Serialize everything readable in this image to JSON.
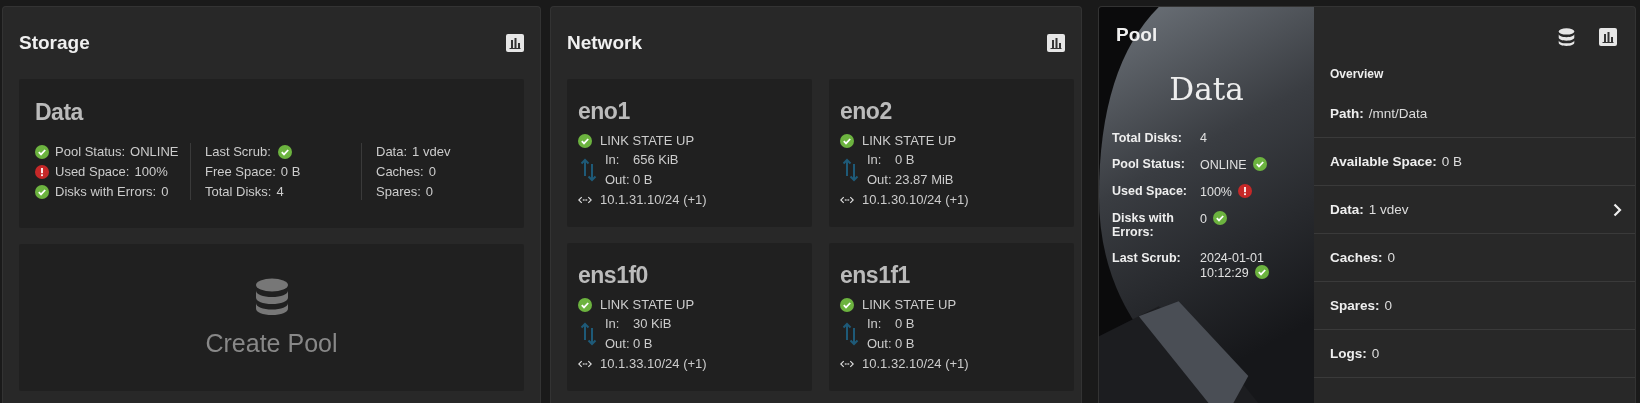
{
  "storage": {
    "title": "Storage",
    "pool": {
      "name": "Data",
      "columns": [
        [
          {
            "label": "Pool Status:",
            "value": "ONLINE",
            "healthy": true
          },
          {
            "label": "Used Space:",
            "value": "100%",
            "healthy": false
          },
          {
            "label": "Disks with Errors:",
            "value": "0",
            "healthy": true
          }
        ],
        [
          {
            "label": "Last Scrub:",
            "healthy": true
          },
          {
            "label": "Free Space:",
            "value": "0 B"
          },
          {
            "label": "Total Disks:",
            "value": "4"
          }
        ],
        [
          {
            "label": "Data:",
            "value": "1 vdev"
          },
          {
            "label": "Caches:",
            "value": "0"
          },
          {
            "label": "Spares:",
            "value": "0"
          }
        ]
      ]
    },
    "create_pool": {
      "label": "Create Pool"
    }
  },
  "network": {
    "title": "Network",
    "interfaces": [
      {
        "name": "eno1",
        "link_state": "LINK STATE UP",
        "link_up": true,
        "in": {
          "label": "In:",
          "value": "656 KiB"
        },
        "out": {
          "label": "Out:",
          "value": "0 B"
        },
        "address": "10.1.31.10/24 (+1)"
      },
      {
        "name": "eno2",
        "link_state": "LINK STATE UP",
        "link_up": true,
        "in": {
          "label": "In:",
          "value": "0 B"
        },
        "out": {
          "label": "Out:",
          "value": "23.87 MiB"
        },
        "address": "10.1.30.10/24 (+1)"
      },
      {
        "name": "ens1f0",
        "link_state": "LINK STATE UP",
        "link_up": true,
        "in": {
          "label": "In:",
          "value": "30 KiB"
        },
        "out": {
          "label": "Out:",
          "value": "0 B"
        },
        "address": "10.1.33.10/24 (+1)"
      },
      {
        "name": "ens1f1",
        "link_state": "LINK STATE UP",
        "link_up": true,
        "in": {
          "label": "In:",
          "value": "0 B"
        },
        "out": {
          "label": "Out:",
          "value": "0 B"
        },
        "address": "10.1.32.10/24 (+1)"
      }
    ]
  },
  "pool": {
    "title": "Pool",
    "name": "Data",
    "stats": [
      {
        "label": "Total Disks:",
        "value": "4"
      },
      {
        "label": "Pool Status:",
        "value": "ONLINE",
        "healthy": true
      },
      {
        "label": "Used Space:",
        "value": "100%",
        "healthy": false
      },
      {
        "label": "Disks with Errors:",
        "value": "0",
        "healthy": true
      },
      {
        "label": "Last Scrub:",
        "value": "2024-01-01 10:12:29",
        "healthy": true
      }
    ],
    "overview": {
      "heading": "Overview",
      "rows": [
        {
          "label": "Path:",
          "value": "/mnt/Data",
          "expandable": false
        },
        {
          "label": "Available Space:",
          "value": "0 B",
          "expandable": false
        },
        {
          "label": "Data:",
          "value": "1 vdev",
          "expandable": true
        },
        {
          "label": "Caches:",
          "value": "0",
          "expandable": false
        },
        {
          "label": "Spares:",
          "value": "0",
          "expandable": false
        },
        {
          "label": "Logs:",
          "value": "0",
          "expandable": false
        }
      ]
    }
  }
}
